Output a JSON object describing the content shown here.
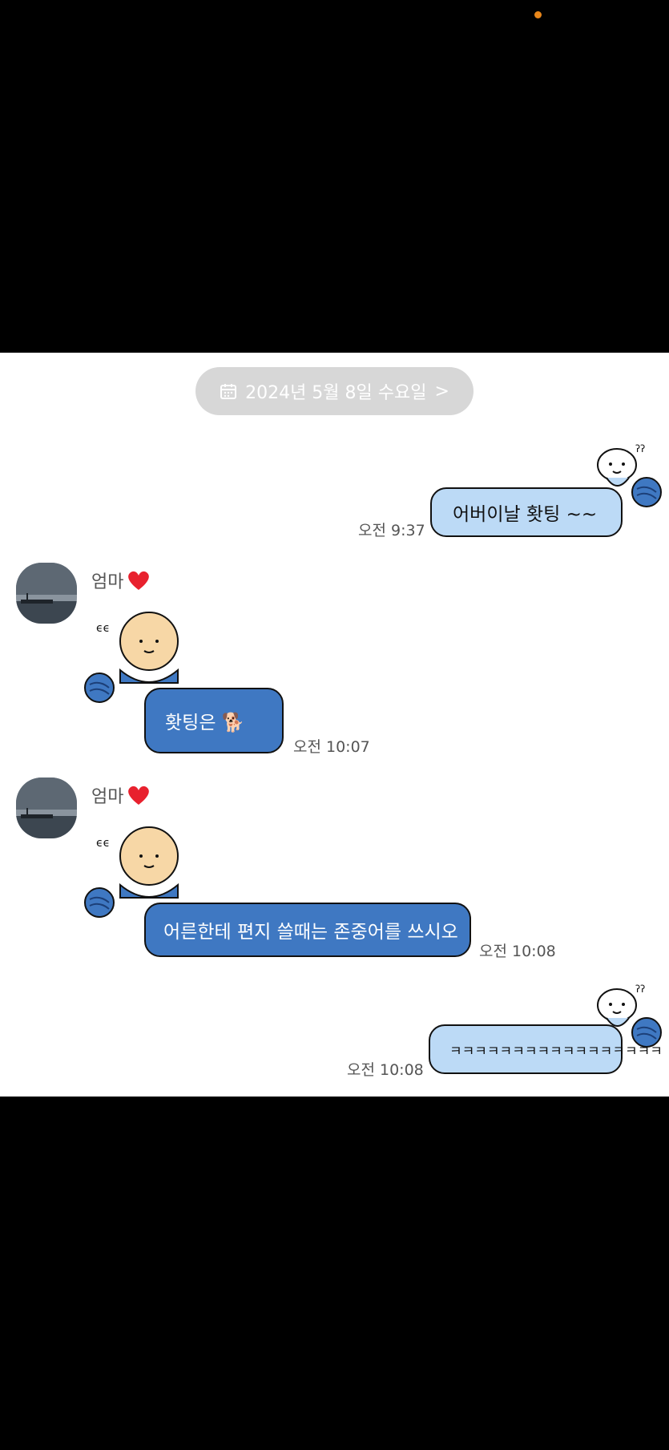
{
  "date_divider": {
    "label": "2024년 5월 8일 수요일",
    "chevron": ">",
    "icon": "calendar-icon"
  },
  "contact": {
    "name": "엄마",
    "heart": "heart-icon"
  },
  "messages": [
    {
      "sender": "me",
      "text": "어버이날 홧팅 ~~",
      "time": "오전 9:37"
    },
    {
      "sender": "엄마",
      "text": "홧팅은 🐕",
      "time": "오전 10:07"
    },
    {
      "sender": "엄마",
      "text": "어른한테 편지 쓸때는 존중어를 쓰시오",
      "time": "오전 10:08"
    },
    {
      "sender": "me",
      "text": "ㅋㅋㅋㅋㅋㅋㅋㅋㅋㅋㅋㅋㅋㅋㅋㅋㅋ",
      "time": "오전 10:08"
    }
  ],
  "colors": {
    "mine_bubble": "#bcdaf6",
    "mom_bubble": "#3f78c2",
    "divider": "#d7d7d7",
    "status_dot": "#e8861a"
  }
}
